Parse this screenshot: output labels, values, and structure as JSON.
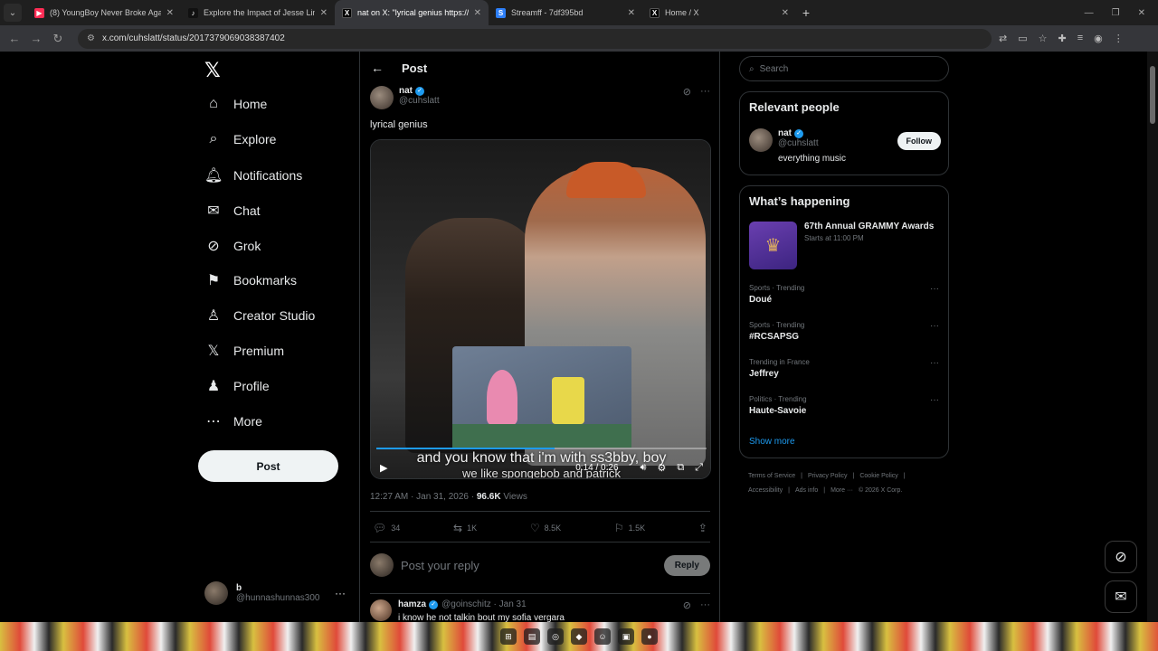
{
  "browser": {
    "tabs": [
      {
        "title": "(8) YoungBoy Never Broke Again",
        "favicon_color": "#e1306c",
        "icon": "youtube-icon"
      },
      {
        "title": "Explore the Impact of Jesse Lingard",
        "favicon_color": "#000000",
        "icon": "tiktok-icon"
      },
      {
        "title": "nat on X: \"lyrical genius https://...",
        "favicon_color": "#000000",
        "icon": "x-icon",
        "active": true
      },
      {
        "title": "Streamff - 7df395bd",
        "favicon_color": "#2d7ff9",
        "icon": "streamff-icon"
      },
      {
        "title": "Home / X",
        "favicon_color": "#000000",
        "icon": "x-icon"
      }
    ],
    "new_tab": "+",
    "url": "x.com/cuhslatt/status/2017379069038387402"
  },
  "nav": {
    "logo": "𝕏",
    "items": [
      {
        "label": "Home",
        "icon": "home-icon",
        "glyph": "⌂"
      },
      {
        "label": "Explore",
        "icon": "search-icon",
        "glyph": "⌕"
      },
      {
        "label": "Notifications",
        "icon": "bell-icon",
        "glyph": "🔔︎"
      },
      {
        "label": "Chat",
        "icon": "mail-icon",
        "glyph": "✉"
      },
      {
        "label": "Grok",
        "icon": "grok-icon",
        "glyph": "⊘"
      },
      {
        "label": "Bookmarks",
        "icon": "bookmark-icon",
        "glyph": "⚑"
      },
      {
        "label": "Creator Studio",
        "icon": "creator-studio-icon",
        "glyph": "♙"
      },
      {
        "label": "Premium",
        "icon": "x-premium-icon",
        "glyph": "𝕏"
      },
      {
        "label": "Profile",
        "icon": "profile-icon",
        "glyph": "♟"
      },
      {
        "label": "More",
        "icon": "more-circle-icon",
        "glyph": "⋯"
      }
    ],
    "post_label": "Post",
    "account": {
      "name": "b",
      "handle": "@hunnashunnas300",
      "more": "···"
    }
  },
  "post": {
    "header": "Post",
    "author_name": "nat",
    "author_handle": "@cuhslatt",
    "text": "lyrical genius",
    "caption_line1": "and you know that i'm with ss3bby, boy",
    "caption_line2": "we like spongebob and patrick",
    "video_time": "0:14 / 0:26",
    "progress": 0.54,
    "timestamp": "12:27 AM · Jan 31, 2026 · ",
    "views_count": "96.6K",
    "views_label": " Views",
    "replies": "34",
    "reposts": "1K",
    "likes": "8.5K",
    "bookmarks": "1.5K",
    "reply_placeholder": "Post your reply",
    "reply_button": "Reply"
  },
  "comment": {
    "name": "hamza",
    "handle": "@goinschitz · Jan 31",
    "text": "i know he not talkin bout my sofia vergara"
  },
  "right": {
    "search_placeholder": "Search",
    "relevant_title": "Relevant people",
    "person": {
      "name": "nat",
      "handle": "@cuhslatt",
      "bio": "everything music",
      "follow": "Follow"
    },
    "happening_title": "What’s happening",
    "event": {
      "title": "67th Annual GRAMMY Awards",
      "sub": "Starts at 11:00 PM"
    },
    "trends": [
      {
        "category": "Sports · Trending",
        "name": "Doué"
      },
      {
        "category": "Sports · Trending",
        "name": "#RCSAPSG"
      },
      {
        "category": "Trending in France",
        "name": "Jeffrey"
      },
      {
        "category": "Politics · Trending",
        "name": "Haute-Savoie"
      }
    ],
    "show_more": "Show more",
    "footer": [
      "Terms of Service",
      "|",
      "Privacy Policy",
      "|",
      "Cookie Policy",
      "|",
      "Accessibility",
      "|",
      "Ads info",
      "|",
      "More ···",
      "© 2026 X Corp."
    ]
  },
  "colors": {
    "accent": "#1d9bf0",
    "background": "#000000",
    "border": "#2f3336",
    "muted": "#71767b"
  }
}
